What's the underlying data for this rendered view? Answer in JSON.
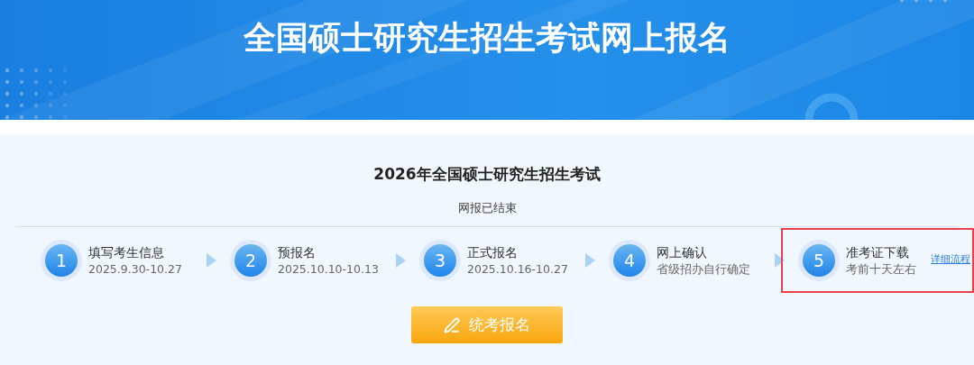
{
  "banner": {
    "title": "全国硕士研究生招生考试网上报名"
  },
  "exam": {
    "title": "2026年全国硕士研究生招生考试",
    "status": "网报已结束"
  },
  "steps": [
    {
      "number": "1",
      "label": "填写考生信息",
      "detail": "2025.9.30-10.27",
      "highlighted": false
    },
    {
      "number": "2",
      "label": "预报名",
      "detail": "2025.10.10-10.13",
      "highlighted": false
    },
    {
      "number": "3",
      "label": "正式报名",
      "detail": "2025.10.16-10.27",
      "highlighted": false
    },
    {
      "number": "4",
      "label": "网上确认",
      "detail": "省级招办自行确定",
      "highlighted": false
    },
    {
      "number": "5",
      "label": "准考证下载",
      "detail": "考前十天左右",
      "highlighted": true
    }
  ],
  "details_link": "详细流程",
  "register_button": "统考报名"
}
